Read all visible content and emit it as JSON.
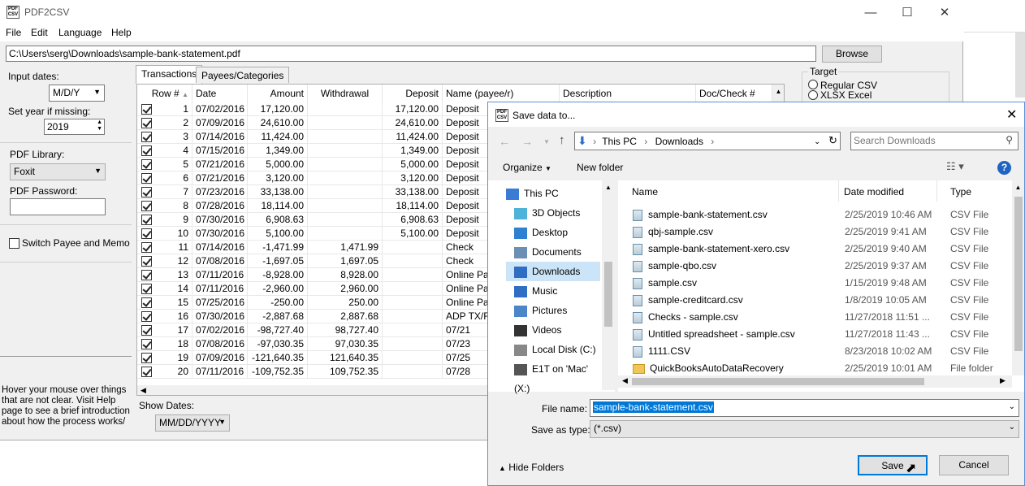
{
  "app": {
    "title": "PDF2CSV",
    "icon_text": "PDF CSV",
    "menu": [
      "File",
      "Edit",
      "Language",
      "Help"
    ],
    "file_path": "C:\\Users\\serg\\Downloads\\sample-bank-statement.pdf",
    "browse_label": "Browse"
  },
  "left_panel": {
    "input_dates_label": "Input dates:",
    "input_dates_value": "M/D/Y",
    "set_year_label": "Set year if missing:",
    "year_value": "2019",
    "pdf_library_label": "PDF Library:",
    "pdf_library_value": "Foxit",
    "pdf_password_label": "PDF Password:",
    "switch_label": "Switch Payee and Memo",
    "hint": "Hover your mouse over things that are not clear. Visit Help page to see a brief introduction about how the process works/"
  },
  "tabs": [
    "Transactions",
    "Payees/Categories"
  ],
  "grid": {
    "columns": [
      "Row #",
      "Date",
      "Amount",
      "Withdrawal",
      "Deposit",
      "Name (payee/r)",
      "Description",
      "Doc/Check #"
    ],
    "rows": [
      [
        "1",
        "07/02/2016",
        "17,120.00",
        "",
        "17,120.00",
        "Deposit"
      ],
      [
        "2",
        "07/09/2016",
        "24,610.00",
        "",
        "24,610.00",
        "Deposit"
      ],
      [
        "3",
        "07/14/2016",
        "11,424.00",
        "",
        "11,424.00",
        "Deposit"
      ],
      [
        "4",
        "07/15/2016",
        "1,349.00",
        "",
        "1,349.00",
        "Deposit"
      ],
      [
        "5",
        "07/21/2016",
        "5,000.00",
        "",
        "5,000.00",
        "Deposit"
      ],
      [
        "6",
        "07/21/2016",
        "3,120.00",
        "",
        "3,120.00",
        "Deposit"
      ],
      [
        "7",
        "07/23/2016",
        "33,138.00",
        "",
        "33,138.00",
        "Deposit"
      ],
      [
        "8",
        "07/28/2016",
        "18,114.00",
        "",
        "18,114.00",
        "Deposit"
      ],
      [
        "9",
        "07/30/2016",
        "6,908.63",
        "",
        "6,908.63",
        "Deposit"
      ],
      [
        "10",
        "07/30/2016",
        "5,100.00",
        "",
        "5,100.00",
        "Deposit"
      ],
      [
        "11",
        "07/14/2016",
        "-1,471.99",
        "1,471.99",
        "",
        "Check"
      ],
      [
        "12",
        "07/08/2016",
        "-1,697.05",
        "1,697.05",
        "",
        "Check"
      ],
      [
        "13",
        "07/11/2016",
        "-8,928.00",
        "8,928.00",
        "",
        "Online Pay"
      ],
      [
        "14",
        "07/11/2016",
        "-2,960.00",
        "2,960.00",
        "",
        "Online Pay"
      ],
      [
        "15",
        "07/25/2016",
        "-250.00",
        "250.00",
        "",
        "Online Pay"
      ],
      [
        "16",
        "07/30/2016",
        "-2,887.68",
        "2,887.68",
        "",
        "ADP TX/Fin"
      ],
      [
        "17",
        "07/02/2016",
        "-98,727.40",
        "98,727.40",
        "",
        "07/21"
      ],
      [
        "18",
        "07/08/2016",
        "-97,030.35",
        "97,030.35",
        "",
        "07/23"
      ],
      [
        "19",
        "07/09/2016",
        "-121,640.35",
        "121,640.35",
        "",
        "07/25"
      ],
      [
        "20",
        "07/11/2016",
        "-109,752.35",
        "109,752.35",
        "",
        "07/28"
      ]
    ]
  },
  "show_dates": {
    "label": "Show Dates:",
    "value": "MM/DD/YYYY"
  },
  "target": {
    "label": "Target",
    "options": [
      "Regular CSV",
      "XLSX Excel"
    ]
  },
  "dialog": {
    "title": "Save data to...",
    "breadcrumb": [
      "This PC",
      "Downloads"
    ],
    "search_placeholder": "Search Downloads",
    "organize_label": "Organize",
    "new_folder_label": "New folder",
    "nav": [
      "This PC",
      "3D Objects",
      "Desktop",
      "Documents",
      "Downloads",
      "Music",
      "Pictures",
      "Videos",
      "Local Disk (C:)",
      "E1T on 'Mac' (X:)"
    ],
    "columns": [
      "Name",
      "Date modified",
      "Type"
    ],
    "files": [
      {
        "name": "sample-bank-statement.csv",
        "date": "2/25/2019 10:46 AM",
        "type": "CSV File"
      },
      {
        "name": "qbj-sample.csv",
        "date": "2/25/2019 9:41 AM",
        "type": "CSV File"
      },
      {
        "name": "sample-bank-statement-xero.csv",
        "date": "2/25/2019 9:40 AM",
        "type": "CSV File"
      },
      {
        "name": "sample-qbo.csv",
        "date": "2/25/2019 9:37 AM",
        "type": "CSV File"
      },
      {
        "name": "sample.csv",
        "date": "1/15/2019 9:48 AM",
        "type": "CSV File"
      },
      {
        "name": "sample-creditcard.csv",
        "date": "1/8/2019 10:05 AM",
        "type": "CSV File"
      },
      {
        "name": "Checks - sample.csv",
        "date": "11/27/2018 11:51 ...",
        "type": "CSV File"
      },
      {
        "name": "Untitled spreadsheet - sample.csv",
        "date": "11/27/2018 11:43 ...",
        "type": "CSV File"
      },
      {
        "name": "1111.CSV",
        "date": "8/23/2018 10:02 AM",
        "type": "CSV File"
      },
      {
        "name": "QuickBooksAutoDataRecovery",
        "date": "2/25/2019 10:01 AM",
        "type": "File folder"
      }
    ],
    "file_name_label": "File name:",
    "file_name_value": "sample-bank-statement.csv",
    "save_type_label": "Save as type:",
    "save_type_value": "(*.csv)",
    "hide_folders_label": "Hide Folders",
    "save_label": "Save",
    "cancel_label": "Cancel"
  }
}
